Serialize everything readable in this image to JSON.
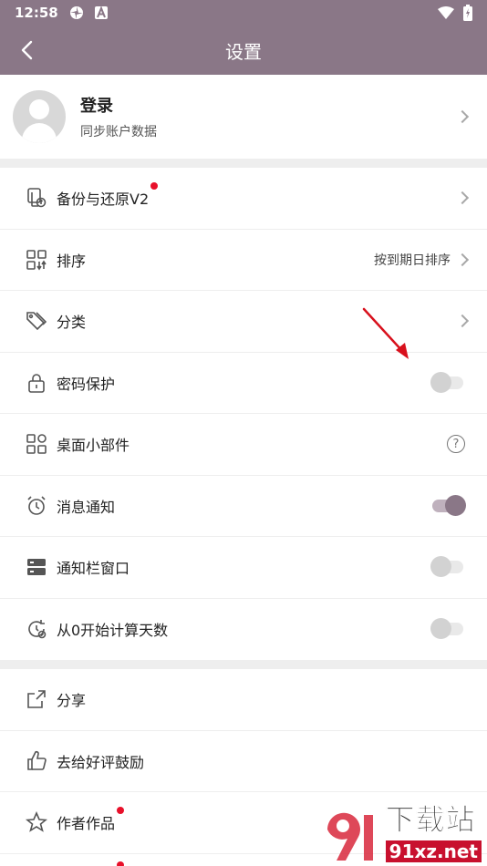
{
  "status_bar": {
    "time": "12:58"
  },
  "app_bar": {
    "title": "设置"
  },
  "account": {
    "title": "登录",
    "subtitle": "同步账户数据"
  },
  "group1": [
    {
      "label": "备份与还原V2",
      "icon": "backup-icon",
      "has_dot": true,
      "chevron": true
    },
    {
      "label": "排序",
      "icon": "sort-icon",
      "value": "按到期日排序",
      "chevron": true
    },
    {
      "label": "分类",
      "icon": "tag-icon",
      "chevron": true
    },
    {
      "label": "密码保护",
      "icon": "lock-icon",
      "toggle": false
    },
    {
      "label": "桌面小部件",
      "icon": "widget-icon",
      "help": "?"
    },
    {
      "label": "消息通知",
      "icon": "alarm-icon",
      "toggle": true
    },
    {
      "label": "通知栏窗口",
      "icon": "notification-bar-icon",
      "toggle": false
    },
    {
      "label": "从0开始计算天数",
      "icon": "day-count-icon",
      "toggle": false
    }
  ],
  "group2": [
    {
      "label": "分享",
      "icon": "share-icon"
    },
    {
      "label": "去给好评鼓励",
      "icon": "thumbs-up-icon"
    },
    {
      "label": "作者作品",
      "icon": "star-icon",
      "has_dot": true
    }
  ],
  "watermark": {
    "brand": "下载站",
    "domain": "91xz.net"
  },
  "colors": {
    "primary": "#8a7787",
    "badge": "#e8102a",
    "arrow": "#d8101c"
  }
}
